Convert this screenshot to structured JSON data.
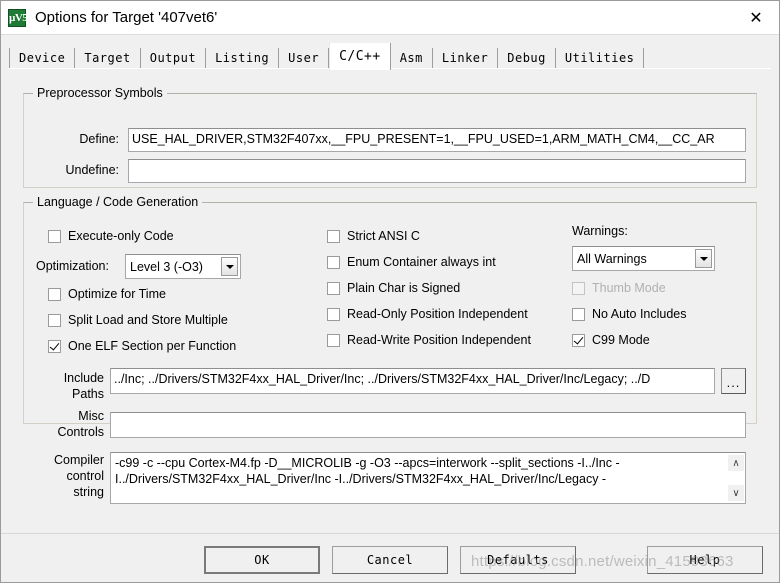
{
  "window": {
    "title": "Options for Target '407vet6'",
    "icon_name": "uvision-icon",
    "icon_text": "µV5",
    "close_label": "✕"
  },
  "tabs": [
    {
      "label": "Device",
      "active": false
    },
    {
      "label": "Target",
      "active": false
    },
    {
      "label": "Output",
      "active": false
    },
    {
      "label": "Listing",
      "active": false
    },
    {
      "label": "User",
      "active": false
    },
    {
      "label": "C/C++",
      "active": true
    },
    {
      "label": "Asm",
      "active": false
    },
    {
      "label": "Linker",
      "active": false
    },
    {
      "label": "Debug",
      "active": false
    },
    {
      "label": "Utilities",
      "active": false
    }
  ],
  "preprocessor": {
    "legend": "Preprocessor Symbols",
    "define_label": "Define:",
    "define_value": "USE_HAL_DRIVER,STM32F407xx,__FPU_PRESENT=1,__FPU_USED=1,ARM_MATH_CM4,__CC_AR",
    "undefine_label": "Undefine:",
    "undefine_value": ""
  },
  "language": {
    "legend": "Language / Code Generation",
    "left_column": [
      {
        "label": "Execute-only Code",
        "checked": false,
        "disabled": false
      },
      {
        "label": "Optimize for Time",
        "checked": false,
        "disabled": false
      },
      {
        "label": "Split Load and Store Multiple",
        "checked": false,
        "disabled": false
      },
      {
        "label": "One ELF Section per Function",
        "checked": true,
        "disabled": false
      }
    ],
    "optimization_label": "Optimization:",
    "optimization_value": "Level 3 (-O3)",
    "middle_column": [
      {
        "label": "Strict ANSI C",
        "checked": false,
        "disabled": false
      },
      {
        "label": "Enum Container always int",
        "checked": false,
        "disabled": false
      },
      {
        "label": "Plain Char is Signed",
        "checked": false,
        "disabled": false
      },
      {
        "label": "Read-Only Position Independent",
        "checked": false,
        "disabled": false
      },
      {
        "label": "Read-Write Position Independent",
        "checked": false,
        "disabled": false
      }
    ],
    "warnings_label": "Warnings:",
    "warnings_value": "All Warnings",
    "right_column": [
      {
        "label": "Thumb Mode",
        "checked": false,
        "disabled": true
      },
      {
        "label": "No Auto Includes",
        "checked": false,
        "disabled": false
      },
      {
        "label": "C99 Mode",
        "checked": true,
        "disabled": false
      }
    ]
  },
  "paths": {
    "include_label_line1": "Include",
    "include_label_line2": "Paths",
    "include_value": "../Inc; ../Drivers/STM32F4xx_HAL_Driver/Inc; ../Drivers/STM32F4xx_HAL_Driver/Inc/Legacy; ../D",
    "browse_label": "...",
    "misc_label_line1": "Misc",
    "misc_label_line2": "Controls",
    "misc_value": ""
  },
  "compiler": {
    "label_line1": "Compiler",
    "label_line2": "control",
    "label_line3": "string",
    "value": "-c99 -c --cpu Cortex-M4.fp -D__MICROLIB -g -O3 --apcs=interwork --split_sections -I../Inc -\nI../Drivers/STM32F4xx_HAL_Driver/Inc -I../Drivers/STM32F4xx_HAL_Driver/Inc/Legacy -",
    "scroll_up": "∧",
    "scroll_down": "∨"
  },
  "buttons": {
    "ok": "OK",
    "cancel": "Cancel",
    "defaults": "Defaults",
    "help": "Help"
  },
  "watermark": "https://blog.csdn.net/weixin_41593663"
}
